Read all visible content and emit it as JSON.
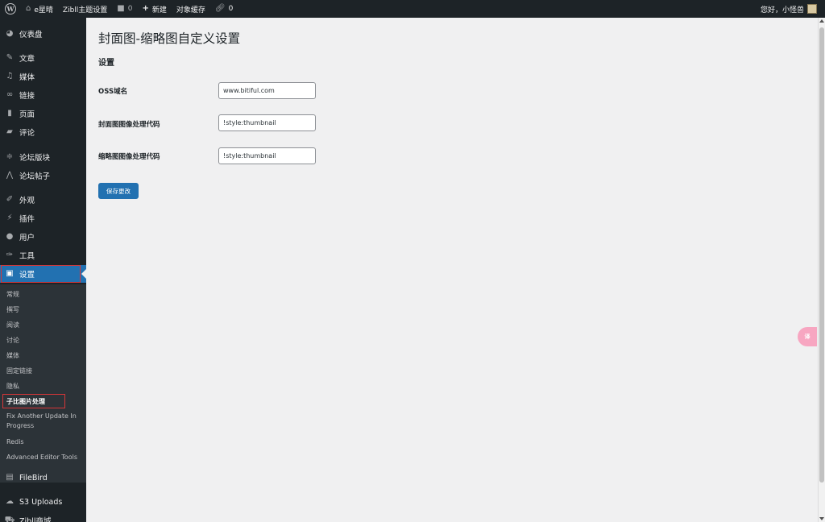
{
  "adminbar": {
    "site_name": "e星晴",
    "theme_settings": "Zibll主题设置",
    "comments_count": "0",
    "new_label": "新建",
    "object_cache": "对象缓存",
    "links_count": "0",
    "greeting": "您好，小怪兽"
  },
  "sidebar": {
    "items": [
      {
        "label": "仪表盘",
        "icon": "dashboard-icon"
      },
      {
        "label": "文章",
        "icon": "pin-icon"
      },
      {
        "label": "媒体",
        "icon": "media-icon"
      },
      {
        "label": "链接",
        "icon": "link-icon"
      },
      {
        "label": "页面",
        "icon": "page-icon"
      },
      {
        "label": "评论",
        "icon": "comment-icon"
      },
      {
        "label": "论坛版块",
        "icon": "forum-icon"
      },
      {
        "label": "论坛帖子",
        "icon": "forum-post-icon"
      },
      {
        "label": "外观",
        "icon": "brush-icon"
      },
      {
        "label": "插件",
        "icon": "plugin-icon"
      },
      {
        "label": "用户",
        "icon": "user-icon"
      },
      {
        "label": "工具",
        "icon": "wrench-icon"
      },
      {
        "label": "设置",
        "icon": "settings-icon"
      },
      {
        "label": "FileBird",
        "icon": "filebird-icon"
      },
      {
        "label": "S3 Uploads",
        "icon": "cloud-icon"
      },
      {
        "label": "Zibll商城",
        "icon": "shop-icon"
      }
    ],
    "submenu": [
      "常规",
      "撰写",
      "阅读",
      "讨论",
      "媒体",
      "固定链接",
      "隐私",
      "子比图片处理",
      "Fix Another Update In Progress",
      "Redis",
      "Advanced Editor Tools"
    ]
  },
  "main": {
    "title": "封面图-缩略图自定义设置",
    "section": "设置",
    "fields": [
      {
        "label": "OSS域名",
        "value": "www.bitiful.com"
      },
      {
        "label": "封面图图像处理代码",
        "value": "!style:thumbnail"
      },
      {
        "label": "缩略图图像处理代码",
        "value": "!style:thumbnail"
      }
    ],
    "save_label": "保存更改"
  },
  "translate_fab": "译",
  "colors": {
    "adminbar_bg": "#1d2327",
    "sidebar_bg": "#1d2327",
    "submenu_bg": "#2c3338",
    "accent": "#2271b1",
    "highlight_border": "#d63638",
    "page_bg": "#f0f0f1"
  }
}
